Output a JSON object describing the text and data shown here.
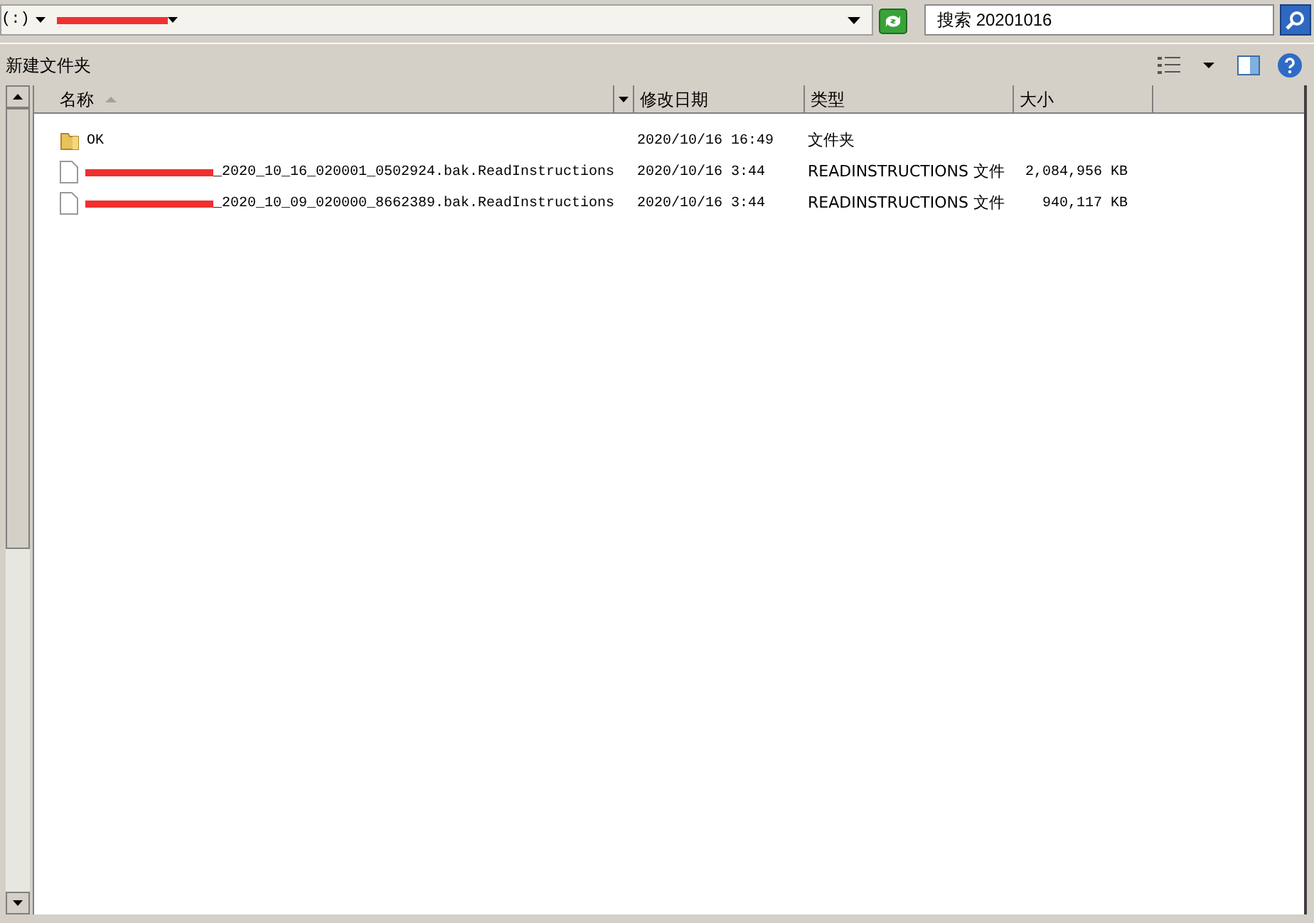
{
  "address_bar": {
    "path": "(:)"
  },
  "search": {
    "placeholder": "搜索 20201016"
  },
  "toolbar": {
    "new_folder": "新建文件夹"
  },
  "table": {
    "columns": [
      {
        "label": "名称",
        "sorted": true
      },
      {
        "label": "修改日期",
        "sorted": false
      },
      {
        "label": "类型",
        "sorted": false
      },
      {
        "label": "大小",
        "sorted": false
      }
    ],
    "rows": [
      {
        "kind": "folder",
        "name": "OK",
        "modified": "2020/10/16 16:49",
        "type": "文件夹"
      },
      {
        "kind": "file",
        "name": "_2020_10_16_020001_0502924.bak.ReadInstructions",
        "modified": "2020/10/16 3:44",
        "type": "READINSTRUCTIONS 文件",
        "size": "2,084,956 KB"
      },
      {
        "kind": "file",
        "name": "_2020_10_09_020000_8662389.bak.ReadInstructions",
        "modified": "2020/10/16 3:44",
        "type": "READINSTRUCTIONS 文件",
        "size": "940,117 KB"
      }
    ]
  }
}
